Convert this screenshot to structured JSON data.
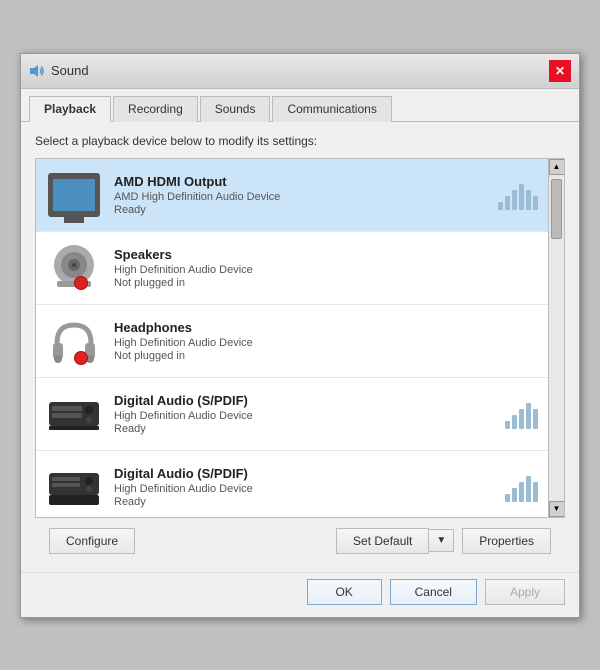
{
  "dialog": {
    "title": "Sound",
    "icon": "speaker-icon"
  },
  "tabs": [
    {
      "label": "Playback",
      "active": true
    },
    {
      "label": "Recording",
      "active": false
    },
    {
      "label": "Sounds",
      "active": false
    },
    {
      "label": "Communications",
      "active": false
    }
  ],
  "content": {
    "instruction": "Select a playback device below to modify its settings:",
    "devices": [
      {
        "name": "AMD HDMI Output",
        "driver": "AMD High Definition Audio Device",
        "status": "Ready",
        "iconType": "tv",
        "selected": true,
        "showBars": true
      },
      {
        "name": "Speakers",
        "driver": "High Definition Audio Device",
        "status": "Not plugged in",
        "iconType": "speaker",
        "selected": false,
        "showBars": false,
        "redDot": true
      },
      {
        "name": "Headphones",
        "driver": "High Definition Audio Device",
        "status": "Not plugged in",
        "iconType": "headphone",
        "selected": false,
        "showBars": false,
        "redDot": true
      },
      {
        "name": "Digital Audio (S/PDIF)",
        "driver": "High Definition Audio Device",
        "status": "Ready",
        "iconType": "digital",
        "selected": false,
        "showBars": true
      },
      {
        "name": "Digital Audio (S/PDIF)",
        "driver": "High Definition Audio Device",
        "status": "Ready",
        "iconType": "digital2",
        "selected": false,
        "showBars": true
      }
    ]
  },
  "buttons": {
    "configure": "Configure",
    "set_default": "Set Default",
    "properties": "Properties",
    "ok": "OK",
    "cancel": "Cancel",
    "apply": "Apply"
  }
}
